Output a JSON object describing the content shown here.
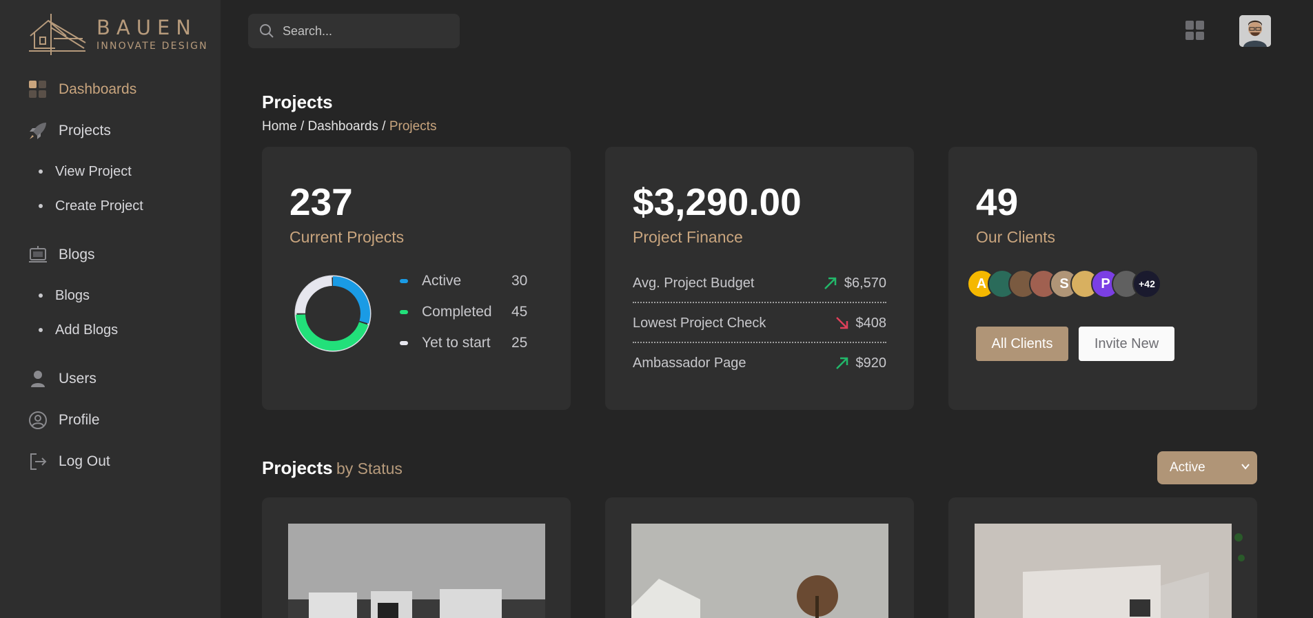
{
  "brand": {
    "title": "BAUEN",
    "subtitle": "INNOVATE DESIGN"
  },
  "sidebar": {
    "items": [
      {
        "label": "Dashboards",
        "icon": "dashboard-icon",
        "active": true
      },
      {
        "label": "Projects",
        "icon": "rocket-icon"
      },
      {
        "label": "View Project",
        "sub": true
      },
      {
        "label": "Create Project",
        "sub": true
      },
      {
        "label": "Blogs",
        "icon": "blog-icon"
      },
      {
        "label": "Blogs",
        "sub": true
      },
      {
        "label": "Add Blogs",
        "sub": true
      },
      {
        "label": "Users",
        "icon": "user-icon"
      },
      {
        "label": "Profile",
        "icon": "profile-icon"
      },
      {
        "label": "Log Out",
        "icon": "logout-icon"
      }
    ]
  },
  "search": {
    "placeholder": "Search..."
  },
  "page": {
    "title": "Projects",
    "breadcrumb": [
      "Home",
      "Dashboards",
      "Projects"
    ]
  },
  "cards": {
    "projects": {
      "value": "237",
      "label": "Current Projects",
      "legend": [
        {
          "name": "Active",
          "value": "30",
          "color": "#1a9be5"
        },
        {
          "name": "Completed",
          "value": "45",
          "color": "#22e07a"
        },
        {
          "name": "Yet to start",
          "value": "25",
          "color": "#e6e6ee"
        }
      ]
    },
    "finance": {
      "value": "$3,290.00",
      "label": "Project Finance",
      "rows": [
        {
          "name": "Avg. Project Budget",
          "amount": "$6,570",
          "trend": "up"
        },
        {
          "name": "Lowest Project Check",
          "amount": "$408",
          "trend": "down"
        },
        {
          "name": "Ambassador Page",
          "amount": "$920",
          "trend": "up"
        }
      ]
    },
    "clients": {
      "value": "49",
      "label": "Our Clients",
      "avatars": [
        {
          "initial": "A",
          "color": "#f5b800"
        },
        {
          "initial": "",
          "color": "#2a6b5a"
        },
        {
          "initial": "",
          "color": "#7a5a40"
        },
        {
          "initial": "",
          "color": "#a06050"
        },
        {
          "initial": "S",
          "color": "#b09577"
        },
        {
          "initial": "",
          "color": "#d8b060"
        },
        {
          "initial": "P",
          "color": "#7b3fe4"
        },
        {
          "initial": "",
          "color": "#606060"
        }
      ],
      "more": "+42",
      "primary_button": "All Clients",
      "secondary_button": "Invite New"
    }
  },
  "status_section": {
    "title": "Projects",
    "subtitle": "by Status",
    "filter": "Active"
  }
}
